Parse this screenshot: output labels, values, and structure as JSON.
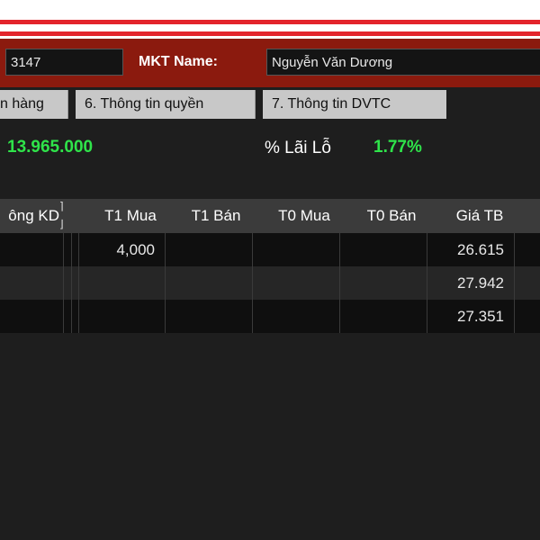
{
  "header": {
    "account_value": "3147",
    "mkt_label": "MKT Name:",
    "mkt_name_value": "Nguyễn Văn Dương"
  },
  "tabs": [
    {
      "label": "n hàng"
    },
    {
      "label": "6. Thông tin quyền"
    },
    {
      "label": "7. Thông tin DVTC"
    }
  ],
  "summary": {
    "amount": "13.965.000",
    "pnl_label": "% Lãi Lỗ",
    "pnl_value": "1.77%"
  },
  "table": {
    "columns": [
      "ông KD",
      "T1 Mua",
      "T1 Bán",
      "T0 Mua",
      "T0 Bán",
      "Giá TB"
    ],
    "rows": [
      {
        "t1_mua": "4,000",
        "gia_tb": "26.615"
      },
      {
        "t1_mua": "",
        "gia_tb": "27.942"
      },
      {
        "t1_mua": "",
        "gia_tb": "27.351"
      }
    ]
  },
  "colors": {
    "accent_red": "#e3242b",
    "header_bg": "#8b1a0e",
    "positive_green": "#2fe44a"
  }
}
